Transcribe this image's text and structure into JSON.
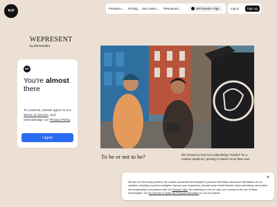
{
  "logo": {
    "text": "WP",
    "icon": "wetransfer-logo-icon"
  },
  "nav": {
    "items": [
      {
        "label": "Features"
      },
      {
        "label": "Pricing"
      },
      {
        "label": "Use cases"
      },
      {
        "label": "Resources"
      }
    ],
    "wetransfer_sign": "WeTransfer Sign"
  },
  "auth": {
    "login": "Log in",
    "signup": "Sign up"
  },
  "brand": {
    "title": "WEPRESENT",
    "by": "by WeTransfer"
  },
  "consent_card": {
    "badge": "WP",
    "headline_prefix": "You're ",
    "headline_bold": "almost",
    "headline_suffix": "there",
    "desc_1": "To continue, please agree to our ",
    "terms_link": "Terms of Service",
    "desc_2": ", and acknowledge our ",
    "privacy_link": "Privacy Policy",
    "desc_3": ".",
    "agree_button": "I agree"
  },
  "article": {
    "title": "To be or not to be?",
    "caption": "Riz Ahmed on how he's radicalizing \"Hamlet\" for a modern audience, proving it matters more than ever"
  },
  "cookie": {
    "text_1": "We and our third-party partners use cookies and similar technologies to process information about your interactions on our websites, including to perform analytics, improve your experience, provide social media features, show advertising, and enable site functionality in accordance with our ",
    "privacy_link": "Privacy Policy",
    "text_2": ". By continuing to use our sites, you consent to the use of these technologies. See ",
    "optout_link": "Do Not Sell or Share My Personal Information",
    "text_3": " for opt-out options.",
    "close": "×"
  },
  "colors": {
    "background": "#ecdfd3",
    "accent": "#2b6bf0",
    "dark": "#111111"
  }
}
